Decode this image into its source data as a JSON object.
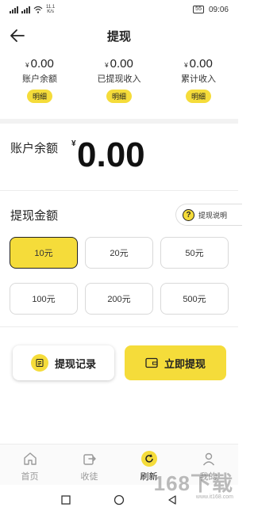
{
  "status_bar": {
    "network_speed": "11.1",
    "speed_unit": "K/s",
    "battery": "55",
    "time": "09:06"
  },
  "header": {
    "title": "提现"
  },
  "stats": [
    {
      "currency": "¥",
      "amount": "0.00",
      "label": "账户余额",
      "detail_label": "明细"
    },
    {
      "currency": "¥",
      "amount": "0.00",
      "label": "已提现收入",
      "detail_label": "明细"
    },
    {
      "currency": "¥",
      "amount": "0.00",
      "label": "累计收入",
      "detail_label": "明细"
    }
  ],
  "balance": {
    "label": "账户余额",
    "currency": "¥",
    "amount": "0.00"
  },
  "withdraw": {
    "amount_label": "提现金额",
    "help_label": "提现说明",
    "help_icon_glyph": "?",
    "options": [
      "10元",
      "20元",
      "50元",
      "100元",
      "200元",
      "500元"
    ],
    "selected_option": "10元"
  },
  "actions": {
    "records_label": "提现记录",
    "withdraw_label": "立即提现"
  },
  "tabbar": [
    {
      "label": "首页",
      "icon": "home-icon",
      "active": false
    },
    {
      "label": "收徒",
      "icon": "share-icon",
      "active": false
    },
    {
      "label": "刷新",
      "icon": "refresh-icon",
      "active": true
    },
    {
      "label": "我的",
      "icon": "user-icon",
      "active": false
    }
  ],
  "watermark": {
    "main": "168下载",
    "url": "www.it168.com"
  },
  "colors": {
    "accent": "#f5dc3a",
    "text": "#222222",
    "muted": "#999999"
  }
}
